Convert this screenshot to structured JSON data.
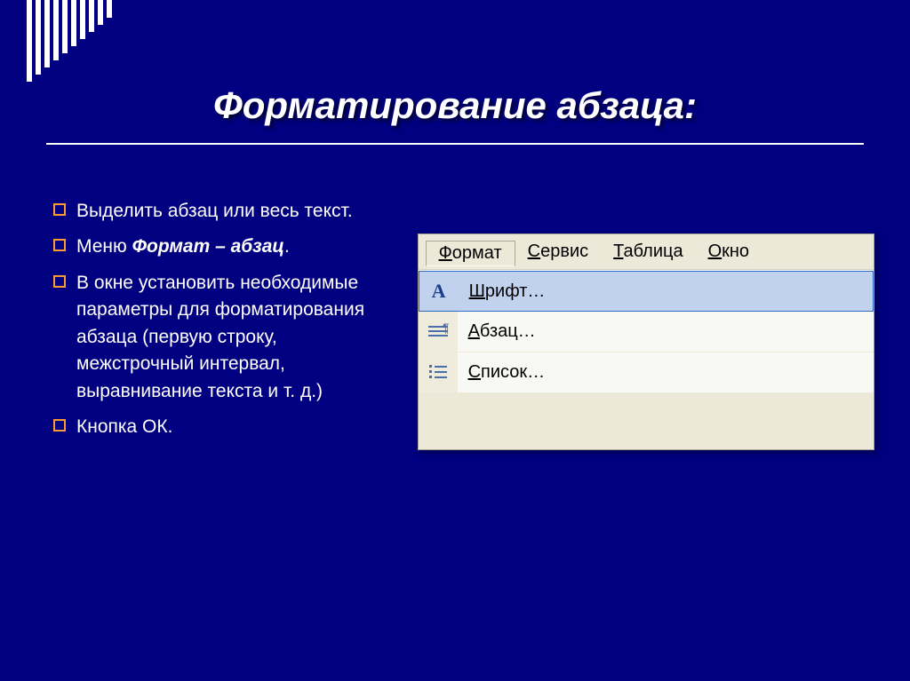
{
  "slide": {
    "title": "Форматирование абзаца:"
  },
  "bullets": [
    {
      "html": "Выделить абзац или весь текст."
    },
    {
      "html": "Меню <b><i>Формат – абзац</i></b>."
    },
    {
      "html": "В окне установить необходимые параметры для форматирования абзаца (первую строку, межстрочный интервал, выравнивание текста и т. д.)"
    },
    {
      "html": "Кнопка ОК."
    }
  ],
  "menu": {
    "bar": [
      {
        "label": "Формат",
        "accel": "Ф",
        "active": true
      },
      {
        "label": "Сервис",
        "accel": "С"
      },
      {
        "label": "Таблица",
        "accel": "Т"
      },
      {
        "label": "Окно",
        "accel": "О"
      }
    ],
    "items": [
      {
        "label": "Шрифт…",
        "accel": "Ш",
        "icon": "font-A",
        "hover": true
      },
      {
        "label": "Абзац…",
        "accel": "А",
        "icon": "para-icon"
      },
      {
        "label": "Список…",
        "accel": "С",
        "icon": "list-icon"
      }
    ]
  },
  "decor_bars": [
    92,
    84,
    76,
    68,
    60,
    52,
    44,
    36,
    28,
    20
  ]
}
